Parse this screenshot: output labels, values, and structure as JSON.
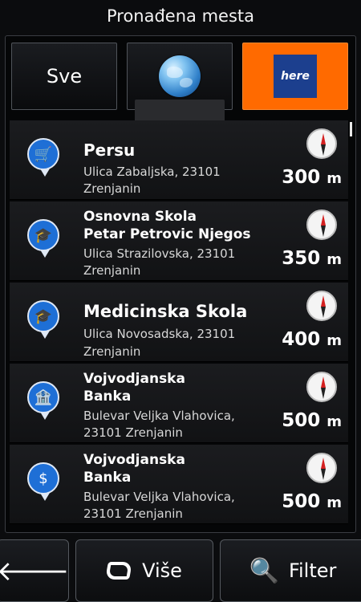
{
  "title": "Pronađena mesta",
  "tabs": {
    "all_label": "Sve",
    "globe_icon": "globe-icon",
    "provider_logo": "here"
  },
  "results": [
    {
      "icon": "shopping-cart-icon",
      "glyph": "🛒",
      "name1": "Persu",
      "name2": "",
      "addr1": "Ulica Zabaljska, 23101",
      "addr2": "Zrenjanin",
      "distance": "300",
      "unit": "m"
    },
    {
      "icon": "school-icon",
      "glyph": "🎓",
      "name1": "Osnovna Skola",
      "name2": "Petar Petrovic Njegos",
      "addr1": "Ulica Strazilovska, 23101",
      "addr2": "Zrenjanin",
      "distance": "350",
      "unit": "m"
    },
    {
      "icon": "school-icon",
      "glyph": "🎓",
      "name1": "Medicinska Skola",
      "name2": "",
      "addr1": "Ulica Novosadska, 23101",
      "addr2": "Zrenjanin",
      "distance": "400",
      "unit": "m"
    },
    {
      "icon": "bank-icon",
      "glyph": "🏦",
      "name1": "Vojvodjanska",
      "name2": "Banka",
      "addr1": "Bulevar Veljka Vlahovica,",
      "addr2": "23101 Zrenjanin",
      "distance": "500",
      "unit": "m"
    },
    {
      "icon": "dollar-icon",
      "glyph": "$",
      "name1": "Vojvodjanska",
      "name2": "Banka",
      "addr1": "Bulevar Veljka Vlahovica,",
      "addr2": "23101 Zrenjanin",
      "distance": "500",
      "unit": "m"
    }
  ],
  "buttons": {
    "more_label": "Više",
    "filter_label": "Filter"
  },
  "colors": {
    "accent_orange": "#ff6a00",
    "pin_blue": "#1e6fd6"
  }
}
